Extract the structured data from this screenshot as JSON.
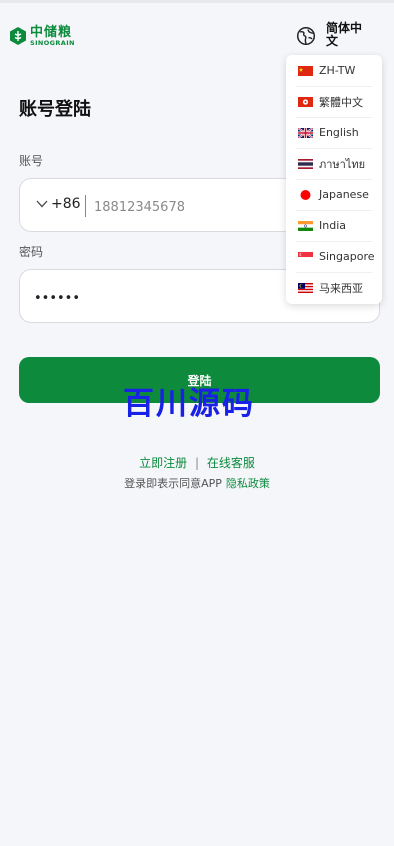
{
  "header": {
    "logo": {
      "cn": "中储粮",
      "en": "SINOGRAIN"
    },
    "language_label": "简体中文",
    "language_icon": "globe-icon"
  },
  "login": {
    "title": "账号登陆",
    "account_label": "账号",
    "country_code": "+86",
    "phone_placeholder": "18812345678",
    "password_label": "密码",
    "password_value": "••••••",
    "login_button": "登陆"
  },
  "footer": {
    "register": "立即注册",
    "divider": "|",
    "customer_service": "在线客服",
    "agree_text": "登录即表示同意APP",
    "privacy_policy": "隐私政策"
  },
  "watermark": "百川源码",
  "languages": [
    {
      "label": "ZH-TW",
      "flag": "cn-flag-icon"
    },
    {
      "label": "繁體中文",
      "flag": "hk-flag-icon"
    },
    {
      "label": "English",
      "flag": "uk-flag-icon"
    },
    {
      "label": "ภาษาไทย",
      "flag": "thai-flag-icon"
    },
    {
      "label": "Japanese",
      "flag": "japan-flag-icon"
    },
    {
      "label": "India",
      "flag": "india-flag-icon"
    },
    {
      "label": "Singapore",
      "flag": "singapore-flag-icon"
    },
    {
      "label": "马来西亚",
      "flag": "malaysia-flag-icon"
    }
  ],
  "colors": {
    "brand_green": "#0d8a3b",
    "background": "#f5f6fa",
    "watermark_blue": "#1a21e6"
  }
}
